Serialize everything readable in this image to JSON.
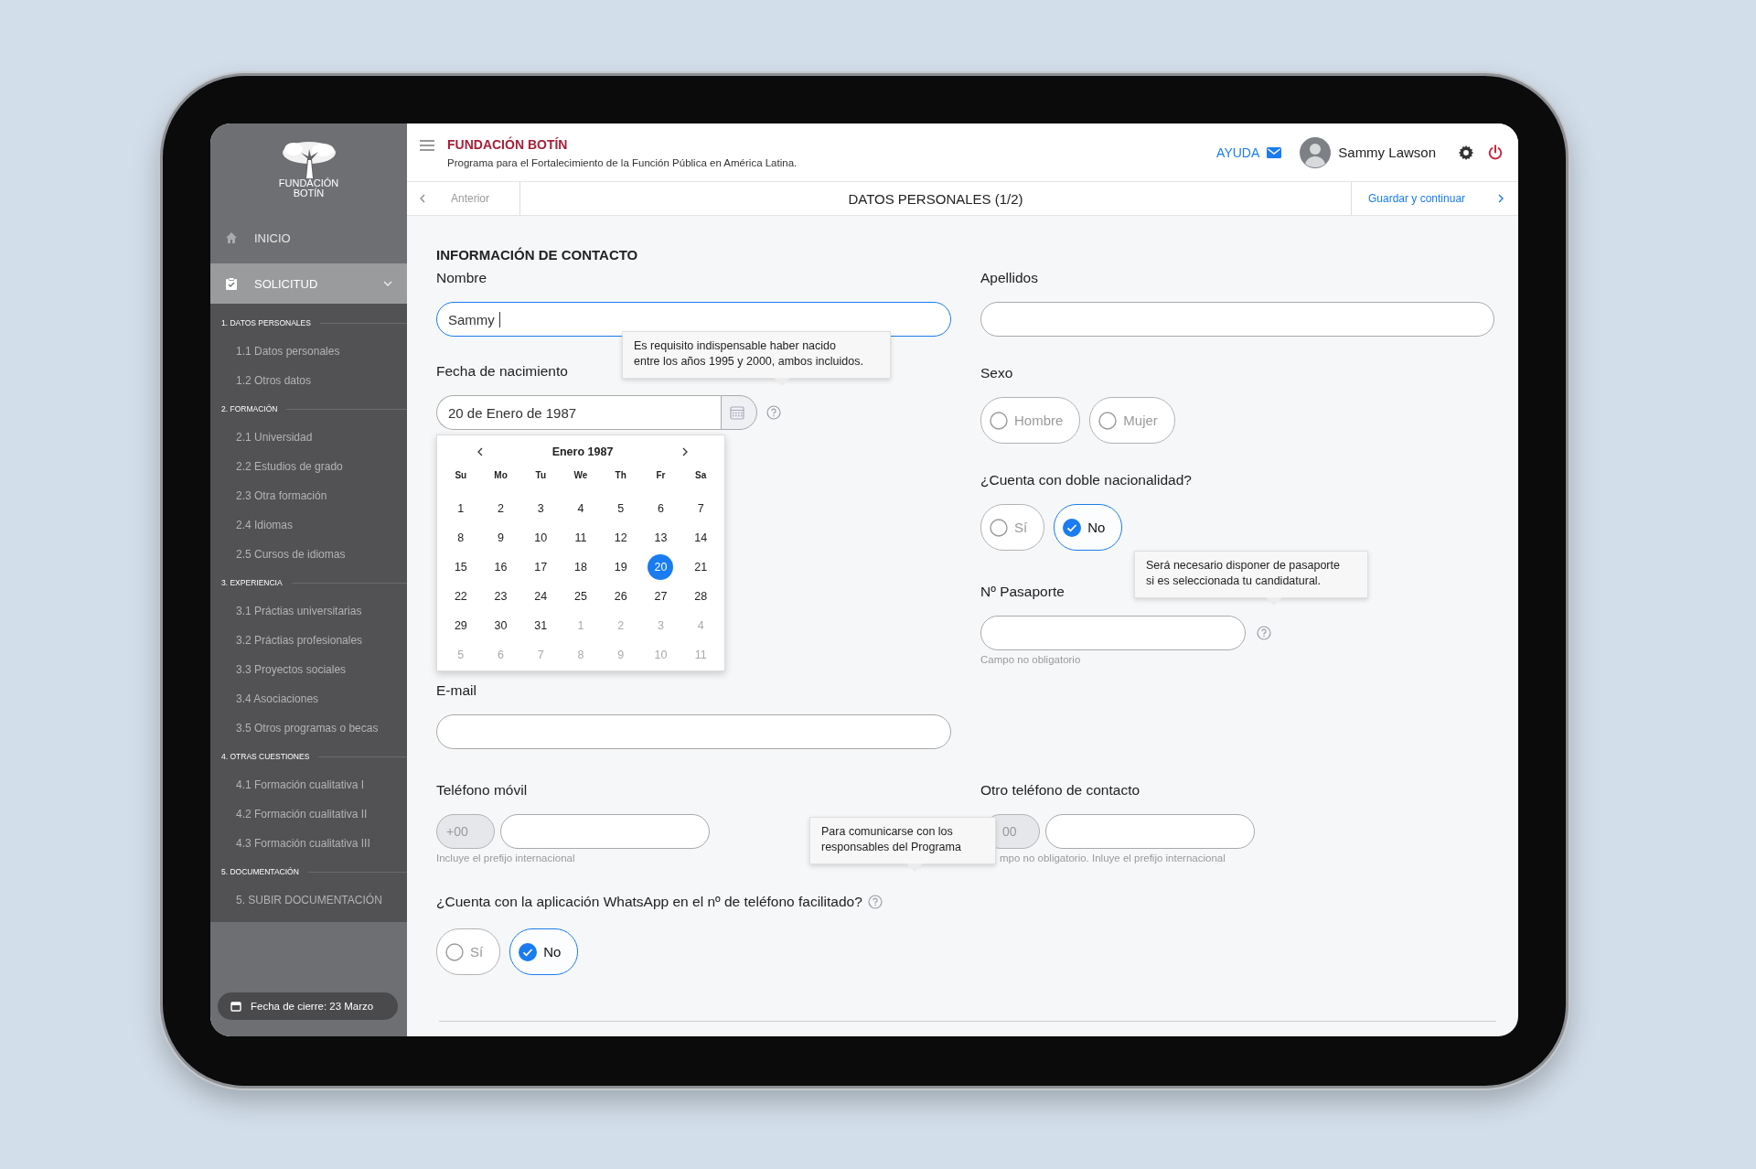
{
  "sidebar": {
    "logo_lines": [
      "FUNDACIÓN",
      "BOTÍN"
    ],
    "main_items": [
      {
        "label": "INICIO",
        "kind": "home",
        "selected": false,
        "expanded": false
      },
      {
        "label": "SOLICITUD",
        "kind": "application",
        "selected": true,
        "expanded": true
      }
    ],
    "sections": [
      {
        "title": "1. DATOS PERSONALES",
        "items": [
          "1.1 Datos personales",
          "1.2 Otros datos"
        ]
      },
      {
        "title": "2. FORMACIÓN",
        "items": [
          "2.1 Universidad",
          "2.2 Estudios de grado",
          "2.3 Otra formación",
          "2.4 Idiomas",
          "2.5 Cursos de idiomas"
        ]
      },
      {
        "title": "3. EXPERIENCIA",
        "items": [
          "3.1 Práctias universitarias",
          "3.2 Práctias profesionales",
          "3.3 Proyectos sociales",
          "3.4 Asociaciones",
          "3.5 Otros programas o becas"
        ]
      },
      {
        "title": "4. OTRAS CUESTIONES",
        "items": [
          "4.1 Formación cualitativa I",
          "4.2 Formación cualitativa II",
          "4.3 Formación cualitativa III"
        ]
      },
      {
        "title": "5. DOCUMENTACIÓN",
        "items": [
          "5. SUBIR DOCUMENTACIÓN"
        ]
      }
    ],
    "closing_date": "Fecha de cierre: 23 Marzo"
  },
  "header": {
    "brand": "FUNDACIÓN BOTÍN",
    "subtitle": "Programa para el Fortalecimiento de la Función Pública en América Latina.",
    "help_label": "AYUDA",
    "user_name": "Sammy Lawson"
  },
  "nav": {
    "prev_label": "Anterior",
    "title": "DATOS PERSONALES (1/2)",
    "next_label": "Guardar y continuar"
  },
  "form": {
    "heading": "INFORMACIÓN DE CONTACTO",
    "nombre": {
      "label": "Nombre",
      "value": "Sammy",
      "focused": true
    },
    "apellidos": {
      "label": "Apellidos"
    },
    "fecha": {
      "label": "Fecha de nacimiento",
      "value": "20 de Enero de 1987"
    },
    "datepicker": {
      "month_label": "Enero 1987",
      "weekdays": [
        "Su",
        "Mo",
        "Tu",
        "We",
        "Th",
        "Fr",
        "Sa"
      ],
      "days": [
        {
          "label": "1",
          "muted": false,
          "selected": false
        },
        {
          "label": "2",
          "muted": false,
          "selected": false
        },
        {
          "label": "3",
          "muted": false,
          "selected": false
        },
        {
          "label": "4",
          "muted": false,
          "selected": false
        },
        {
          "label": "5",
          "muted": false,
          "selected": false
        },
        {
          "label": "6",
          "muted": false,
          "selected": false
        },
        {
          "label": "7",
          "muted": false,
          "selected": false
        },
        {
          "label": "8",
          "muted": false,
          "selected": false
        },
        {
          "label": "9",
          "muted": false,
          "selected": false
        },
        {
          "label": "10",
          "muted": false,
          "selected": false
        },
        {
          "label": "11",
          "muted": false,
          "selected": false
        },
        {
          "label": "12",
          "muted": false,
          "selected": false
        },
        {
          "label": "13",
          "muted": false,
          "selected": false
        },
        {
          "label": "14",
          "muted": false,
          "selected": false
        },
        {
          "label": "15",
          "muted": false,
          "selected": false
        },
        {
          "label": "16",
          "muted": false,
          "selected": false
        },
        {
          "label": "17",
          "muted": false,
          "selected": false
        },
        {
          "label": "18",
          "muted": false,
          "selected": false
        },
        {
          "label": "19",
          "muted": false,
          "selected": false
        },
        {
          "label": "20",
          "muted": false,
          "selected": true
        },
        {
          "label": "21",
          "muted": false,
          "selected": false
        },
        {
          "label": "22",
          "muted": false,
          "selected": false
        },
        {
          "label": "23",
          "muted": false,
          "selected": false
        },
        {
          "label": "24",
          "muted": false,
          "selected": false
        },
        {
          "label": "25",
          "muted": false,
          "selected": false
        },
        {
          "label": "26",
          "muted": false,
          "selected": false
        },
        {
          "label": "27",
          "muted": false,
          "selected": false
        },
        {
          "label": "28",
          "muted": false,
          "selected": false
        },
        {
          "label": "29",
          "muted": false,
          "selected": false
        },
        {
          "label": "30",
          "muted": false,
          "selected": false
        },
        {
          "label": "31",
          "muted": false,
          "selected": false
        },
        {
          "label": "1",
          "muted": true,
          "selected": false
        },
        {
          "label": "2",
          "muted": true,
          "selected": false
        },
        {
          "label": "3",
          "muted": true,
          "selected": false
        },
        {
          "label": "4",
          "muted": true,
          "selected": false
        },
        {
          "label": "5",
          "muted": true,
          "selected": false
        },
        {
          "label": "6",
          "muted": true,
          "selected": false
        },
        {
          "label": "7",
          "muted": true,
          "selected": false
        },
        {
          "label": "8",
          "muted": true,
          "selected": false
        },
        {
          "label": "9",
          "muted": true,
          "selected": false
        },
        {
          "label": "10",
          "muted": true,
          "selected": false
        },
        {
          "label": "11",
          "muted": true,
          "selected": false
        }
      ]
    },
    "sexo": {
      "label": "Sexo",
      "options": [
        {
          "label": "Hombre",
          "selected": false
        },
        {
          "label": "Mujer",
          "selected": false
        }
      ]
    },
    "doble_nacionalidad": {
      "label": "¿Cuenta con doble nacionalidad?",
      "options": [
        {
          "label": "Sí",
          "selected": false
        },
        {
          "label": "No",
          "selected": true
        }
      ]
    },
    "pasaporte": {
      "label": "Nº Pasaporte",
      "hint": "Campo no obligatorio"
    },
    "email": {
      "label": "E-mail"
    },
    "movil": {
      "label": "Teléfono móvil",
      "prefix_placeholder": "+00",
      "hint": "Incluye el prefijo internacional"
    },
    "otro_telefono": {
      "label": "Otro teléfono de contacto",
      "prefix_placeholder": "00",
      "hint": "mpo no obligatorio. Inluye el prefijo internacional"
    },
    "whatsapp": {
      "label": "¿Cuenta con la aplicación WhatsApp en el nº de teléfono facilitado?",
      "options": [
        {
          "label": "Sí",
          "selected": false
        },
        {
          "label": "No",
          "selected": true
        }
      ]
    }
  },
  "tooltips": [
    {
      "lines": [
        "Es requisito indispensable haber nacido",
        "entre los años 1995 y 2000, ambos incluidos."
      ]
    },
    {
      "lines": [
        "Será necesario disponer de pasaporte",
        "si es seleccionada tu candidatural."
      ]
    },
    {
      "lines": [
        "Para comunicarse con los",
        "responsables del Programa"
      ]
    }
  ]
}
